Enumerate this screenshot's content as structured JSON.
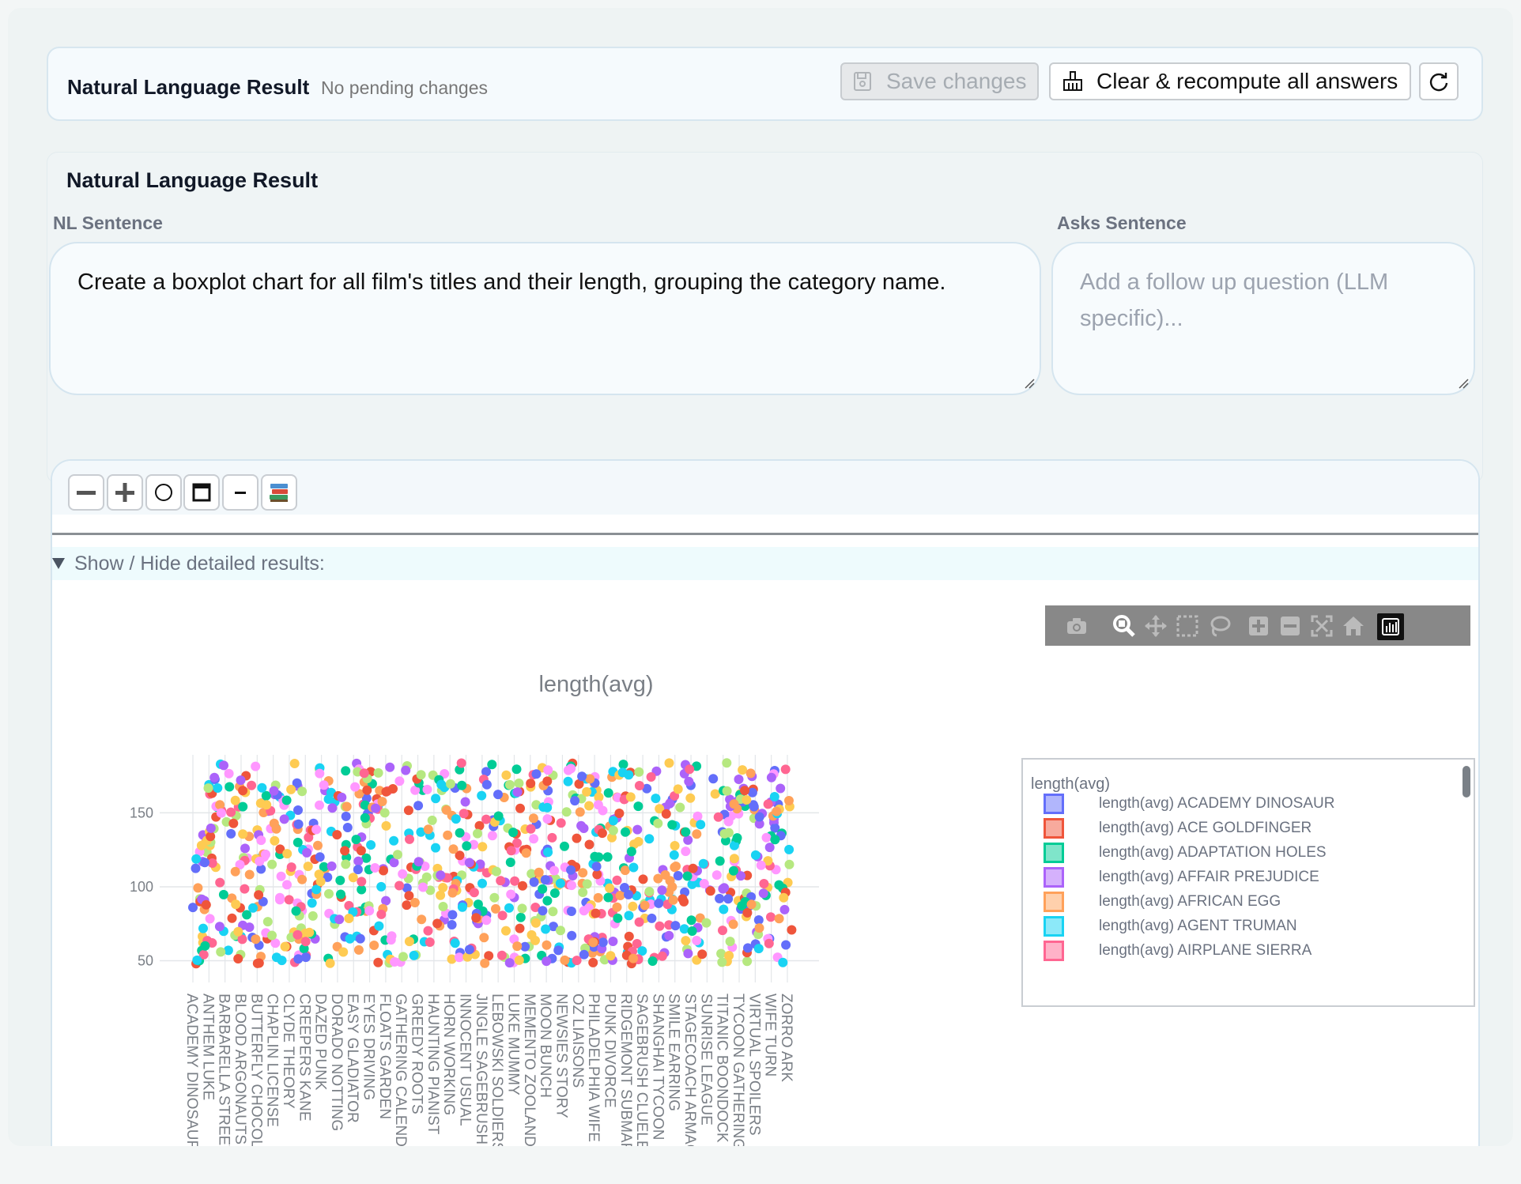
{
  "header": {
    "title": "Natural Language Result",
    "status": "No pending changes",
    "save_label": "Save changes",
    "clear_label": "Clear & recompute all answers"
  },
  "nl_panel": {
    "title": "Natural Language Result",
    "nl_label": "NL Sentence",
    "nl_value": "Create a boxplot chart for all film's titles and their length, grouping the category name.",
    "ask_label": "Asks Sentence",
    "ask_placeholder": "Add a follow up question (LLM specific)..."
  },
  "result": {
    "toolbar_icons": [
      "minus-icon",
      "plus-icon",
      "circle-icon",
      "window-icon",
      "dash-icon",
      "books-icon"
    ],
    "details_label": "Show / Hide detailed results:",
    "modebar_icons": [
      "camera-icon",
      "zoom-icon",
      "pan-icon",
      "box-select-icon",
      "lasso-icon",
      "zoom-in-icon",
      "zoom-out-icon",
      "autoscale-icon",
      "home-icon",
      "plotly-logo-icon"
    ]
  },
  "chart_data": {
    "type": "scatter",
    "title": "length(avg)",
    "ylim": [
      46,
      186
    ],
    "yticks": [
      50,
      100,
      150
    ],
    "x_tick_labels": [
      "ACADEMY DINOSAUR",
      "ANTHEM LUKE",
      "BARBARELLA STREETCAR",
      "BLOOD ARGONAUTS",
      "BUTTERFLY CHOCOLAT",
      "CHAPLIN LICENSE",
      "CLYDE THEORY",
      "CREEPERS KANE",
      "DAZED PUNK",
      "DORADO NOTTING",
      "EASY GLADIATOR",
      "EYES DRIVING",
      "FLOATS GARDEN",
      "GATHERING CALENDAR",
      "GREEDY ROOTS",
      "HAUNTING PIANIST",
      "HORN WORKING",
      "INNOCENT USUAL",
      "JINGLE SAGEBRUSH",
      "LEBOWSKI SOLDIERS",
      "LUKE MUMMY",
      "MEMENTO ZOOLANDER",
      "MOON BUNCH",
      "NEWSIES STORY",
      "OZ LIAISONS",
      "PHILADELPHIA WIFE",
      "PUNK DIVORCE",
      "RIDGEMONT SUBMARINE",
      "SAGEBRUSH CLUELESS",
      "SHANGHAI TYCOON",
      "SMILE EARRING",
      "STAGECOACH ARMAGEDDON",
      "SUNRISE LEAGUE",
      "TITANIC BOONDOCK",
      "TYCOON GATHERING",
      "VIRTUAL SPOILERS",
      "WIFE TURN",
      "ZORRO ARK"
    ],
    "legend_title": "length(avg)",
    "legend_position": "right",
    "grid": true,
    "series_colors": [
      "#636efa",
      "#ef553b",
      "#00cc96",
      "#ab63fa",
      "#ffa15a",
      "#19d3f3",
      "#ff6692",
      "#b6e880",
      "#ff97ff",
      "#fecb52"
    ],
    "series": [
      {
        "name": "length(avg) ACADEMY DINOSAUR",
        "x": "ACADEMY DINOSAUR",
        "y": 86
      },
      {
        "name": "length(avg) ACE GOLDFINGER",
        "x": "ACE GOLDFINGER",
        "y": 48
      },
      {
        "name": "length(avg) ADAPTATION HOLES",
        "x": "ADAPTATION HOLES",
        "y": 50
      },
      {
        "name": "length(avg) AFFAIR PREJUDICE",
        "x": "AFFAIR PREJUDICE",
        "y": 117
      },
      {
        "name": "length(avg) AFRICAN EGG",
        "x": "AFRICAN EGG",
        "y": 130
      },
      {
        "name": "length(avg) AGENT TRUMAN",
        "x": "AGENT TRUMAN",
        "y": 169
      },
      {
        "name": "length(avg) AIRPLANE SIERRA",
        "x": "AIRPLANE SIERRA",
        "y": 62
      }
    ]
  }
}
